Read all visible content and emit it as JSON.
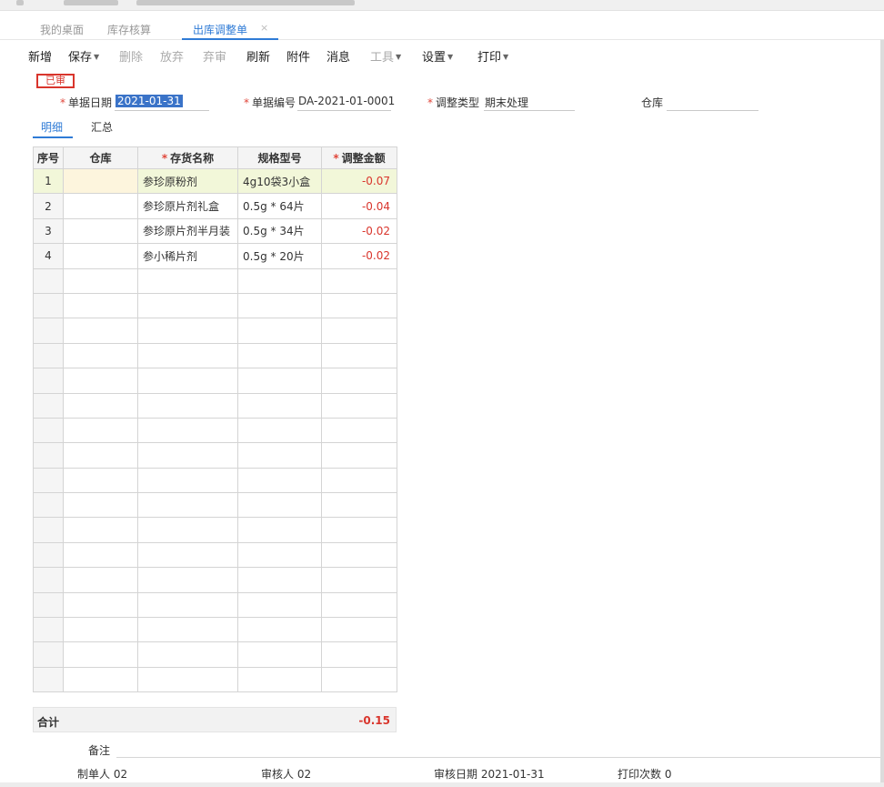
{
  "tabs": [
    {
      "label": "我的桌面"
    },
    {
      "label": "库存核算"
    },
    {
      "label": "出库调整单"
    }
  ],
  "toolbar": [
    "新增",
    "保存",
    "删除",
    "放弃",
    "弃审",
    "刷新",
    "附件",
    "消息",
    "工具",
    "设置",
    "打印"
  ],
  "status_stamp": "已审",
  "form": {
    "date_label": "单据日期",
    "date_value": "2021-01-31",
    "code_label": "单据编号",
    "code_value": "DA-2021-01-0001",
    "type_label": "调整类型",
    "type_value": "期末处理",
    "warehouse_label": "仓库",
    "warehouse_value": ""
  },
  "subtabs": [
    "明细",
    "汇总"
  ],
  "grid": {
    "headers": [
      "序号",
      "仓库",
      "存货名称",
      "规格型号",
      "调整金额"
    ],
    "rows": [
      {
        "no": "1",
        "warehouse": "",
        "name": "参珍原粉剂",
        "spec": "4g10袋3小盒",
        "amount": "-0.07"
      },
      {
        "no": "2",
        "warehouse": "",
        "name": "参珍原片剂礼盒",
        "spec": "0.5g * 64片",
        "amount": "-0.04"
      },
      {
        "no": "3",
        "warehouse": "",
        "name": "参珍原片剂半月装",
        "spec": "0.5g * 34片",
        "amount": "-0.02"
      },
      {
        "no": "4",
        "warehouse": "",
        "name": "参小稀片剂",
        "spec": "0.5g * 20片",
        "amount": "-0.02"
      }
    ]
  },
  "total": {
    "label": "合计",
    "value": "-0.15"
  },
  "remark_label": "备注",
  "footer": {
    "maker_label": "制单人",
    "maker_value": "02",
    "auditor_label": "审核人",
    "auditor_value": "02",
    "audit_date_label": "审核日期",
    "audit_date_value": "2021-01-31",
    "print_count_label": "打印次数",
    "print_count_value": "0"
  },
  "colors": {
    "accent": "#2f7bd6",
    "negative": "#d9352c",
    "selected_row": "#f2f7d9"
  }
}
